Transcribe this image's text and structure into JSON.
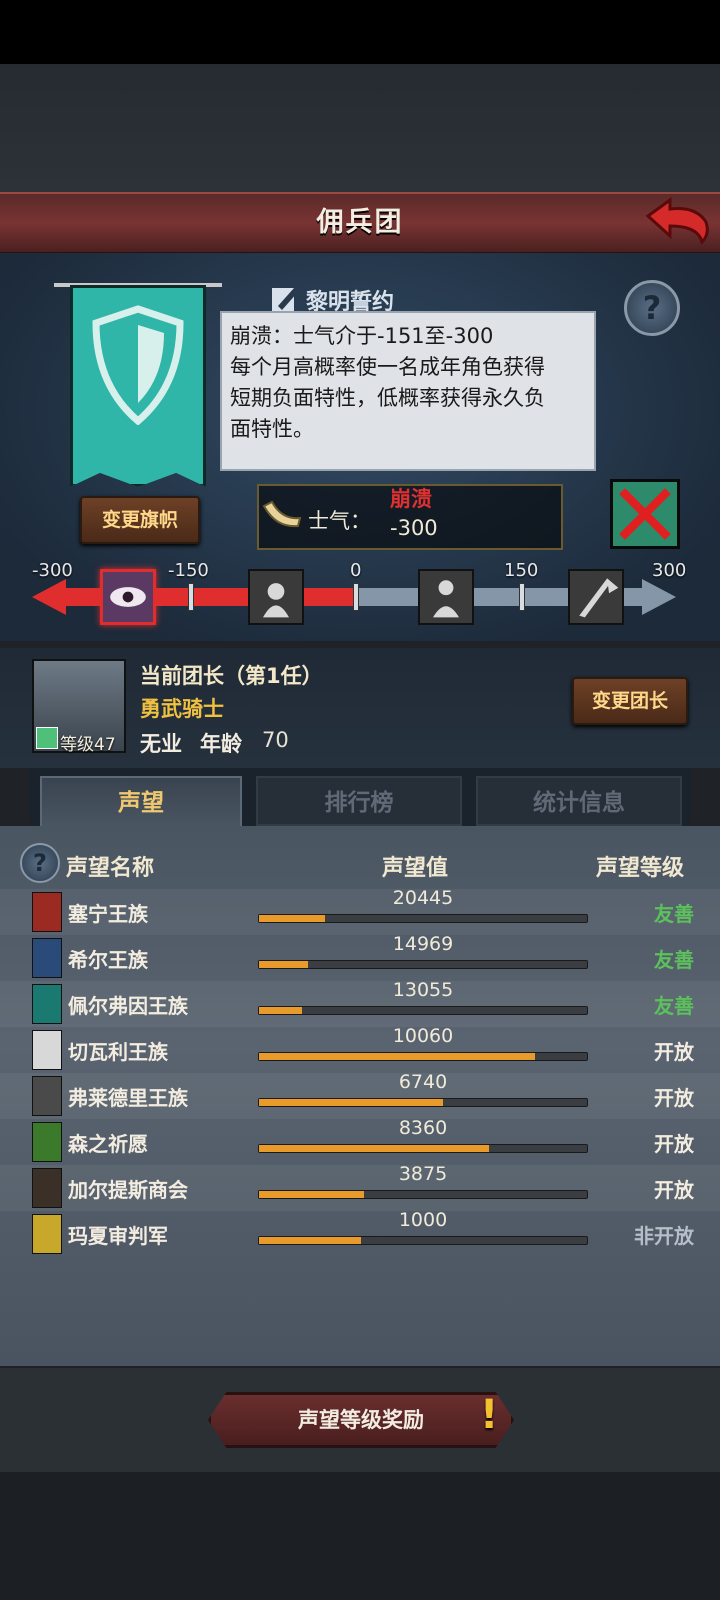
{
  "header": {
    "title": "佣兵团"
  },
  "guild": {
    "name": "黎明誓约",
    "change_flag_label": "变更旗帜",
    "help_label": "?"
  },
  "tooltip": {
    "line1": "崩溃：士气介于-151至-300",
    "line2": "每个月高概率使一名成年角色获得",
    "line3": "短期负面特性，低概率获得永久负",
    "line4": "面特性。"
  },
  "morale": {
    "label": "士气：",
    "state": "崩溃",
    "value": "-300",
    "scale_labels": [
      "-300",
      "-150",
      "0",
      "150",
      "300"
    ],
    "current": -300
  },
  "leader": {
    "title": "当前团长（第1任）",
    "class": "勇武骑士",
    "level_label": "等级47",
    "job": "无业",
    "age_label": "年龄",
    "age": "70",
    "change_leader_label": "变更团长"
  },
  "tabs": [
    {
      "label": "声望"
    },
    {
      "label": "排行榜"
    },
    {
      "label": "统计信息"
    }
  ],
  "reputation": {
    "headers": {
      "name": "声望名称",
      "value": "声望值",
      "level": "声望等级"
    },
    "help_label": "?",
    "rows": [
      {
        "name": "塞宁王族",
        "value": "20445",
        "level": "友善",
        "fill": 0.2,
        "level_color": "#5cc05c",
        "icon_color": "#9a2a22"
      },
      {
        "name": "希尔王族",
        "value": "14969",
        "level": "友善",
        "fill": 0.15,
        "level_color": "#5cc05c",
        "icon_color": "#2a4a7a"
      },
      {
        "name": "佩尔弗因王族",
        "value": "13055",
        "level": "友善",
        "fill": 0.13,
        "level_color": "#5cc05c",
        "icon_color": "#1a7a72"
      },
      {
        "name": "切瓦利王族",
        "value": "10060",
        "level": "开放",
        "fill": 0.84,
        "level_color": "#f3ece0",
        "icon_color": "#d8d8d8"
      },
      {
        "name": "弗莱德里王族",
        "value": "6740",
        "level": "开放",
        "fill": 0.56,
        "level_color": "#f3ece0",
        "icon_color": "#4a4a4a"
      },
      {
        "name": "森之祈愿",
        "value": "8360",
        "level": "开放",
        "fill": 0.7,
        "level_color": "#f3ece0",
        "icon_color": "#3a7a2a"
      },
      {
        "name": "加尔提斯商会",
        "value": "3875",
        "level": "开放",
        "fill": 0.32,
        "level_color": "#f3ece0",
        "icon_color": "#3a3028"
      },
      {
        "name": "玛夏审判军",
        "value": "1000",
        "level": "非开放",
        "fill": 0.31,
        "level_color": "#b6bec8",
        "icon_color": "#c8a82a"
      }
    ]
  },
  "footer": {
    "reward_label": "声望等级奖励",
    "alert_mark": "!"
  },
  "colors": {
    "accent": "#e02e2e",
    "gold": "#f0c040",
    "bar": "#e89a2a"
  },
  "icons": [
    "back-arrow-icon",
    "shield-icon",
    "pen-icon",
    "help-icon",
    "horn-icon",
    "crossed-out-icon",
    "eye-icon",
    "despair-icon",
    "neutral-icon",
    "victory-flag-icon"
  ]
}
